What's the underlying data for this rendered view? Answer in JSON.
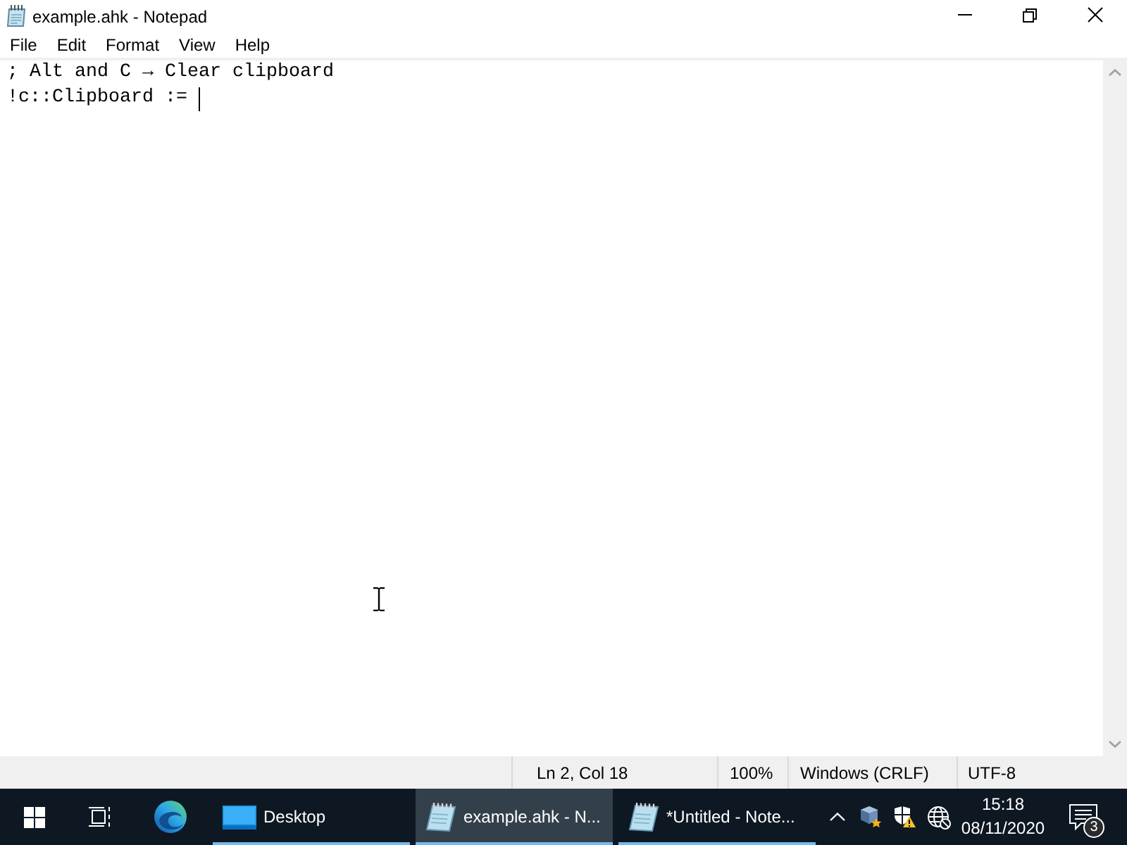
{
  "window": {
    "title": "example.ahk - Notepad"
  },
  "menu": [
    "File",
    "Edit",
    "Format",
    "View",
    "Help"
  ],
  "editor": {
    "lines": [
      {
        "text": "; Alt and C → Clear clipboard",
        "caret": false
      },
      {
        "text": "!c::Clipboard := ",
        "caret": true
      }
    ]
  },
  "status_bar": [
    "Ln 2, Col 18",
    "100%",
    "Windows (CRLF)",
    "UTF-8"
  ],
  "taskbar": {
    "apps": [
      {
        "label": "Desktop",
        "kind": "desktop",
        "selected": false
      },
      {
        "label": "example.ahk - N...",
        "kind": "notepad",
        "selected": true
      },
      {
        "label": "*Untitled - Note...",
        "kind": "notepad",
        "selected": false
      }
    ],
    "clock": {
      "time": "15:18",
      "date": "08/11/2020"
    },
    "notifications": {
      "count": "3"
    }
  }
}
